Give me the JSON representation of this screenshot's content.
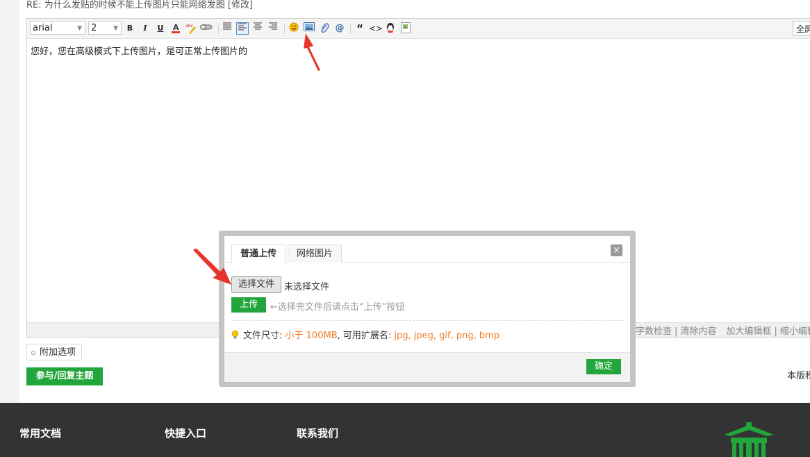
{
  "post": {
    "title": "RE: 为什么发贴的时候不能上传图片只能网络发图 [修改]"
  },
  "editor": {
    "font_family": "arial",
    "font_size": "2",
    "toolbar": {
      "bold": "B",
      "italic": "I",
      "underline": "U",
      "quote": "“",
      "code": "<>"
    },
    "fullscreen_label": "全屏",
    "content": "您好，您在高级模式下上传图片，是可正常上传图片的",
    "status_links": [
      "字数检查",
      "|",
      "清除内容",
      "加大编辑框",
      "|",
      "缩小编辑框"
    ]
  },
  "below_editor": {
    "extra_options_label": "附加选项",
    "reply_button": "参与/回复主题",
    "right_cut_text": "本版积分规则"
  },
  "dialog": {
    "tabs": [
      {
        "label": "普通上传",
        "active": true
      },
      {
        "label": "网络图片",
        "active": false
      }
    ],
    "close_label": "×",
    "choose_file_button": "选择文件",
    "file_status": "未选择文件",
    "upload_button": "上传",
    "upload_hint": "←选择完文件后请点击“上传”按钮",
    "size_label": "文件尺寸:",
    "size_value": "小于 100MB",
    "ext_label": ", 可用扩展名:",
    "ext_value": "jpg, jpeg, gif, png, bmp",
    "ok_button": "确定"
  },
  "footer": {
    "headings": [
      "常用文档",
      "快捷入口",
      "联系我们"
    ]
  },
  "colors": {
    "accent_green": "#22a53a",
    "highlight_orange": "#f27b21",
    "annotation_red": "#e8352b",
    "footer_bg": "#333333"
  }
}
